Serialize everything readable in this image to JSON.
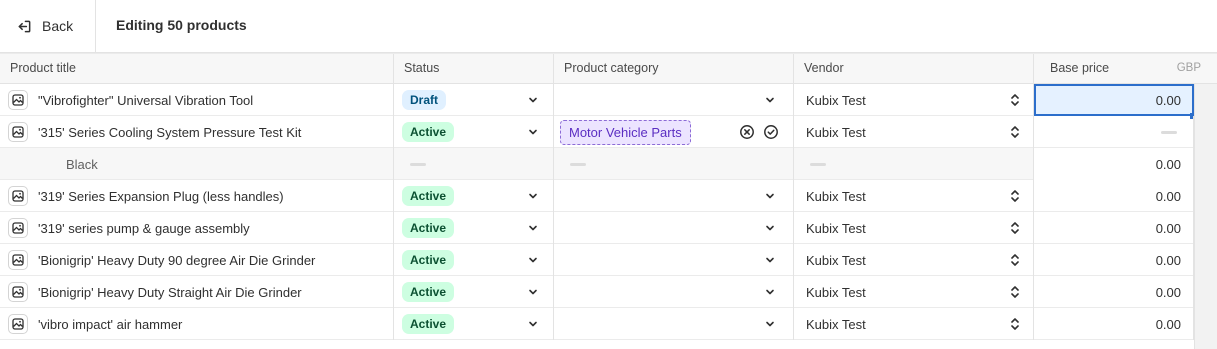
{
  "header": {
    "back_label": "Back",
    "title": "Editing 50 products"
  },
  "columns": {
    "title": "Product title",
    "status": "Status",
    "category": "Product category",
    "vendor": "Vendor",
    "price": "Base price",
    "currency": "GBP"
  },
  "rows": [
    {
      "title": "\"Vibrofighter\" Universal Vibration Tool",
      "status": "Draft",
      "vendor": "Kubix Test",
      "price": "0.00"
    },
    {
      "title": "'315' Series Cooling System Pressure Test Kit",
      "status": "Active",
      "category": "Motor Vehicle Parts",
      "vendor": "Kubix Test",
      "price": ""
    },
    {
      "variant": "Black",
      "price": "0.00"
    },
    {
      "title": "'319' Series Expansion Plug (less handles)",
      "status": "Active",
      "vendor": "Kubix Test",
      "price": "0.00"
    },
    {
      "title": "'319' series pump & gauge assembly",
      "status": "Active",
      "vendor": "Kubix Test",
      "price": "0.00"
    },
    {
      "title": "'Bionigrip' Heavy Duty 90 degree Air Die Grinder",
      "status": "Active",
      "vendor": "Kubix Test",
      "price": "0.00"
    },
    {
      "title": "'Bionigrip' Heavy Duty Straight Air Die Grinder",
      "status": "Active",
      "vendor": "Kubix Test",
      "price": "0.00"
    },
    {
      "title": "'vibro impact' air hammer",
      "status": "Active",
      "vendor": "Kubix Test",
      "price": "0.00"
    }
  ],
  "colors": {
    "accent": "#2c6ecb",
    "draft_bg": "#e0f0ff",
    "active_bg": "#cdfee1",
    "category_chip": "#ece4ff"
  }
}
